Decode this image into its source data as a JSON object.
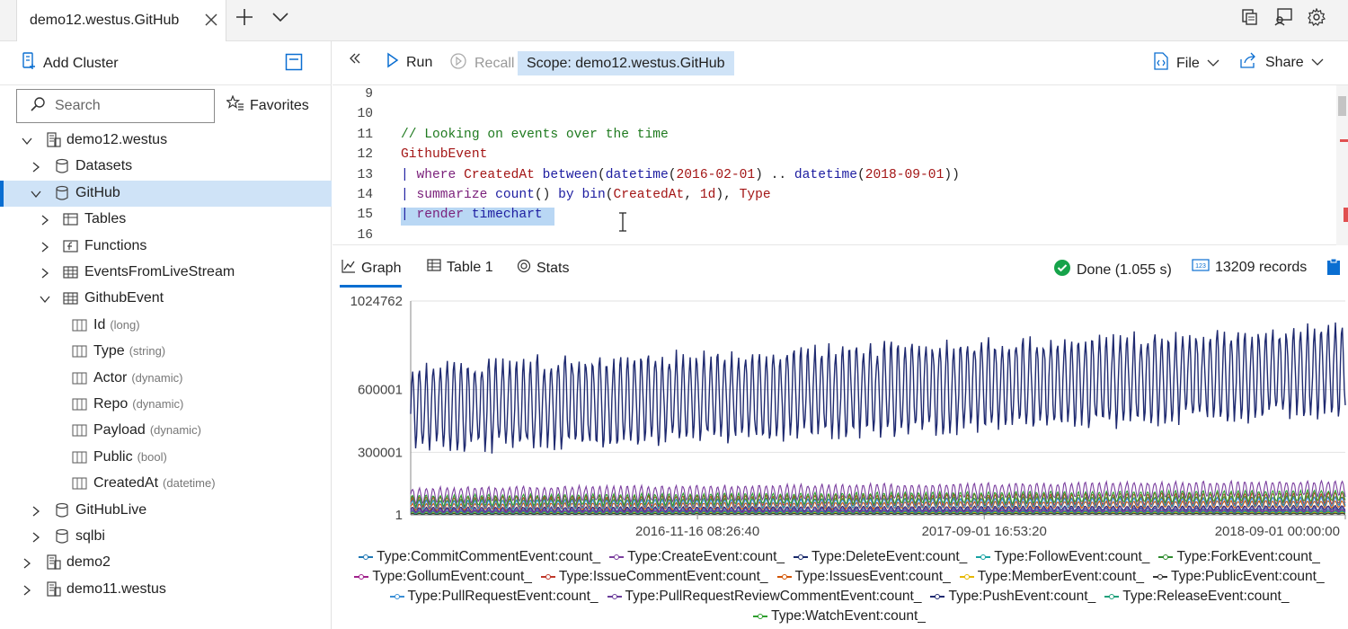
{
  "tabbar": {
    "tab_label": "demo12.westus.GitHub",
    "new_tab_icon": "plus-icon",
    "dropdown_icon": "chevron-down-icon",
    "right_icons": [
      "copy-icon",
      "feedback-icon",
      "settings-icon"
    ]
  },
  "left_panel": {
    "add_cluster_label": "Add Cluster",
    "search_placeholder": "Search",
    "favorites_label": "Favorites",
    "tree": [
      {
        "label": "demo12.westus",
        "type": "",
        "kind": "cluster",
        "level": 0,
        "expanded": true
      },
      {
        "label": "Datasets",
        "type": "",
        "kind": "database",
        "level": 1,
        "expanded": false
      },
      {
        "label": "GitHub",
        "type": "",
        "kind": "database",
        "level": 1,
        "expanded": true,
        "selected": true
      },
      {
        "label": "Tables",
        "type": "",
        "kind": "folder",
        "level": 2,
        "expanded": false
      },
      {
        "label": "Functions",
        "type": "",
        "kind": "function-folder",
        "level": 2,
        "expanded": false
      },
      {
        "label": "EventsFromLiveStream",
        "type": "",
        "kind": "table",
        "level": 2,
        "expanded": false
      },
      {
        "label": "GithubEvent",
        "type": "",
        "kind": "table",
        "level": 2,
        "expanded": true
      },
      {
        "label": "Id",
        "type": "(long)",
        "kind": "column",
        "level": 3
      },
      {
        "label": "Type",
        "type": "(string)",
        "kind": "column",
        "level": 3
      },
      {
        "label": "Actor",
        "type": "(dynamic)",
        "kind": "column",
        "level": 3
      },
      {
        "label": "Repo",
        "type": "(dynamic)",
        "kind": "column",
        "level": 3
      },
      {
        "label": "Payload",
        "type": "(dynamic)",
        "kind": "column",
        "level": 3
      },
      {
        "label": "Public",
        "type": "(bool)",
        "kind": "column",
        "level": 3
      },
      {
        "label": "CreatedAt",
        "type": "(datetime)",
        "kind": "column",
        "level": 3
      },
      {
        "label": "GitHubLive",
        "type": "",
        "kind": "database",
        "level": 1,
        "expanded": false
      },
      {
        "label": "sqlbi",
        "type": "",
        "kind": "database",
        "level": 1,
        "expanded": false
      },
      {
        "label": "demo2",
        "type": "",
        "kind": "cluster",
        "level": 0,
        "expanded": false
      },
      {
        "label": "demo11.westus",
        "type": "",
        "kind": "cluster",
        "level": 0,
        "expanded": false
      }
    ]
  },
  "toolbar": {
    "run_label": "Run",
    "recall_label": "Recall",
    "scope_label": "Scope: demo12.westus.GitHub",
    "file_label": "File",
    "share_label": "Share"
  },
  "editor": {
    "lines": [
      {
        "num": "9",
        "tokens": []
      },
      {
        "num": "10",
        "tokens": []
      },
      {
        "num": "11",
        "tokens": [
          {
            "t": "// Looking on events over the time",
            "c": "comment"
          }
        ]
      },
      {
        "num": "12",
        "tokens": [
          {
            "t": "GithubEvent",
            "c": "table"
          }
        ]
      },
      {
        "num": "13",
        "tokens": [
          {
            "t": "| ",
            "c": "pipe"
          },
          {
            "t": "where ",
            "c": "op"
          },
          {
            "t": "CreatedAt ",
            "c": "col"
          },
          {
            "t": "between",
            "c": "kw"
          },
          {
            "t": "(",
            "c": "plain"
          },
          {
            "t": "datetime",
            "c": "fn"
          },
          {
            "t": "(",
            "c": "plain"
          },
          {
            "t": "2016-02-01",
            "c": "num"
          },
          {
            "t": ") .. ",
            "c": "plain"
          },
          {
            "t": "datetime",
            "c": "fn"
          },
          {
            "t": "(",
            "c": "plain"
          },
          {
            "t": "2018-09-01",
            "c": "num"
          },
          {
            "t": "))",
            "c": "plain"
          }
        ]
      },
      {
        "num": "14",
        "tokens": [
          {
            "t": "| ",
            "c": "pipe"
          },
          {
            "t": "summarize ",
            "c": "op"
          },
          {
            "t": "count",
            "c": "fn"
          },
          {
            "t": "() ",
            "c": "plain"
          },
          {
            "t": "by ",
            "c": "kw"
          },
          {
            "t": "bin",
            "c": "fn"
          },
          {
            "t": "(",
            "c": "plain"
          },
          {
            "t": "CreatedAt",
            "c": "col"
          },
          {
            "t": ", ",
            "c": "plain"
          },
          {
            "t": "1d",
            "c": "num"
          },
          {
            "t": "), ",
            "c": "plain"
          },
          {
            "t": "Type",
            "c": "col"
          }
        ]
      },
      {
        "num": "15",
        "tokens": [
          {
            "t": "| ",
            "c": "pipe"
          },
          {
            "t": "render ",
            "c": "op"
          },
          {
            "t": "timechart",
            "c": "kw"
          }
        ]
      },
      {
        "num": "16",
        "tokens": []
      }
    ]
  },
  "results": {
    "tab_graph": "Graph",
    "tab_table": "Table 1",
    "tab_stats": "Stats",
    "status": "Done (1.055 s)",
    "records": "13209 records"
  },
  "chart_data": {
    "type": "line",
    "title": "",
    "xlabel": "",
    "ylabel": "",
    "y_ticks": [
      "1",
      "300001",
      "600001",
      "1024762"
    ],
    "x_ticks": [
      "2016-11-16 08:26:40",
      "2017-09-01 16:53:20",
      "2018-09-01 00:00:00"
    ],
    "x_range": [
      "2016-02-01",
      "2018-09-01"
    ],
    "ylim": [
      1,
      1024762
    ],
    "grid": "horizontal",
    "legend_position": "bottom",
    "series": [
      {
        "name": "Type:CommitCommentEvent:count_",
        "color": "#1f77b4",
        "approx_level": 20000,
        "amp": 8000
      },
      {
        "name": "Type:CreateEvent:count_",
        "color": "#7b3f9e",
        "approx_level": 110000,
        "amp": 35000
      },
      {
        "name": "Type:DeleteEvent:count_",
        "color": "#1a2a6c",
        "approx_level": 30000,
        "amp": 10000
      },
      {
        "name": "Type:FollowEvent:count_",
        "color": "#17a2a2",
        "approx_level": 10000,
        "amp": 4000
      },
      {
        "name": "Type:ForkEvent:count_",
        "color": "#2e8b2e",
        "approx_level": 60000,
        "amp": 20000
      },
      {
        "name": "Type:GollumEvent:count_",
        "color": "#a0218c",
        "approx_level": 15000,
        "amp": 6000
      },
      {
        "name": "Type:IssueCommentEvent:count_",
        "color": "#c0392b",
        "approx_level": 70000,
        "amp": 25000
      },
      {
        "name": "Type:IssuesEvent:count_",
        "color": "#d35400",
        "approx_level": 45000,
        "amp": 15000
      },
      {
        "name": "Type:MemberEvent:count_",
        "color": "#e6b800",
        "approx_level": 8000,
        "amp": 3000
      },
      {
        "name": "Type:PublicEvent:count_",
        "color": "#333333",
        "approx_level": 5000,
        "amp": 2000
      },
      {
        "name": "Type:PullRequestEvent:count_",
        "color": "#3a8fd6",
        "approx_level": 55000,
        "amp": 20000
      },
      {
        "name": "Type:PullRequestReviewCommentEvent:count_",
        "color": "#6a3d9a",
        "approx_level": 25000,
        "amp": 10000
      },
      {
        "name": "Type:PushEvent:count_",
        "color": "#1f2a70",
        "approx_level": 600000,
        "amp": 200000
      },
      {
        "name": "Type:ReleaseEvent:count_",
        "color": "#1fa07a",
        "approx_level": 12000,
        "amp": 5000
      },
      {
        "name": "Type:WatchEvent:count_",
        "color": "#2e9e2e",
        "approx_level": 80000,
        "amp": 25000
      }
    ]
  }
}
